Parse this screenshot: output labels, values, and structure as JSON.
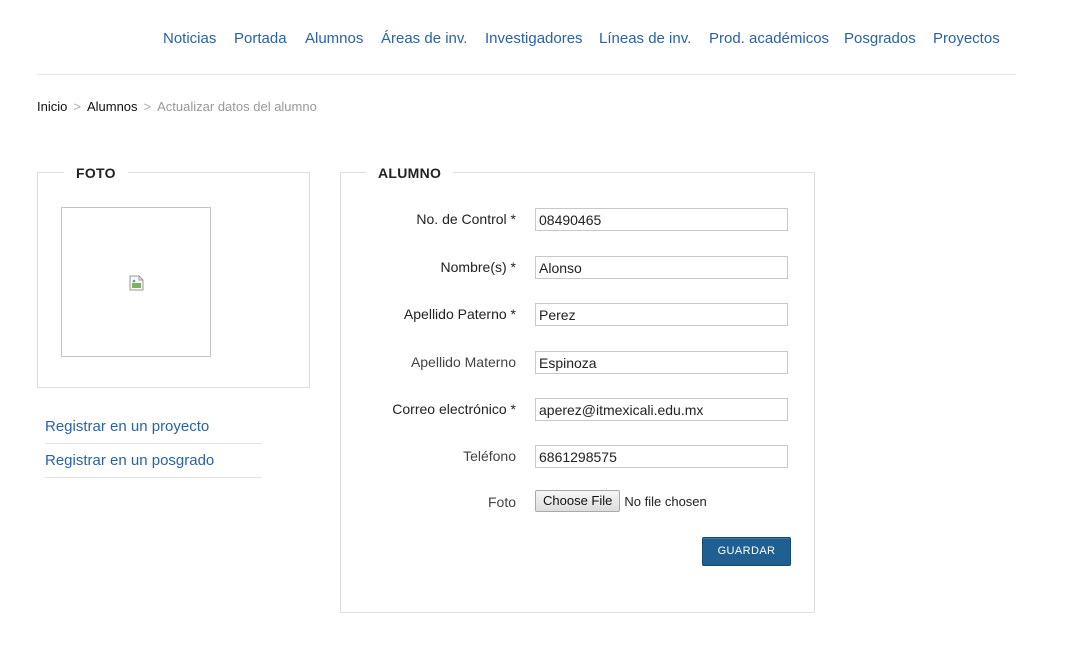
{
  "nav": {
    "items": [
      {
        "label": "Noticias"
      },
      {
        "label": "Portada"
      },
      {
        "label": "Alumnos"
      },
      {
        "label": "Áreas de inv."
      },
      {
        "label": "Investigadores"
      },
      {
        "label": "Líneas de inv."
      },
      {
        "label": "Prod. académicos"
      },
      {
        "label": "Posgrados"
      },
      {
        "label": "Proyectos"
      }
    ]
  },
  "breadcrumb": {
    "items": [
      "Inicio",
      "Alumnos"
    ],
    "separator": ">",
    "current": "Actualizar datos del alumno"
  },
  "foto_panel": {
    "legend": "FOTO",
    "image_icon": "broken-image-icon"
  },
  "side_links": [
    {
      "label": "Registrar en un proyecto"
    },
    {
      "label": "Registrar en un posgrado"
    }
  ],
  "alumno_form": {
    "legend": "ALUMNO",
    "fields": [
      {
        "label": "No. de Control *",
        "value": "08490465"
      },
      {
        "label": "Nombre(s) *",
        "value": "Alonso"
      },
      {
        "label": "Apellido Paterno *",
        "value": "Perez"
      },
      {
        "label": "Apellido Materno",
        "value": "Espinoza"
      },
      {
        "label": "Correo electrónico *",
        "value": "aperez@itmexicali.edu.mx"
      },
      {
        "label": "Teléfono",
        "value": "6861298575"
      }
    ],
    "foto_field": {
      "label": "Foto",
      "button_label": "Choose File",
      "status": "No file chosen"
    },
    "save_label": "GUARDAR"
  },
  "colors": {
    "link": "#2a62a8",
    "primary_button": "#1f5f92",
    "border": "#dedede"
  }
}
